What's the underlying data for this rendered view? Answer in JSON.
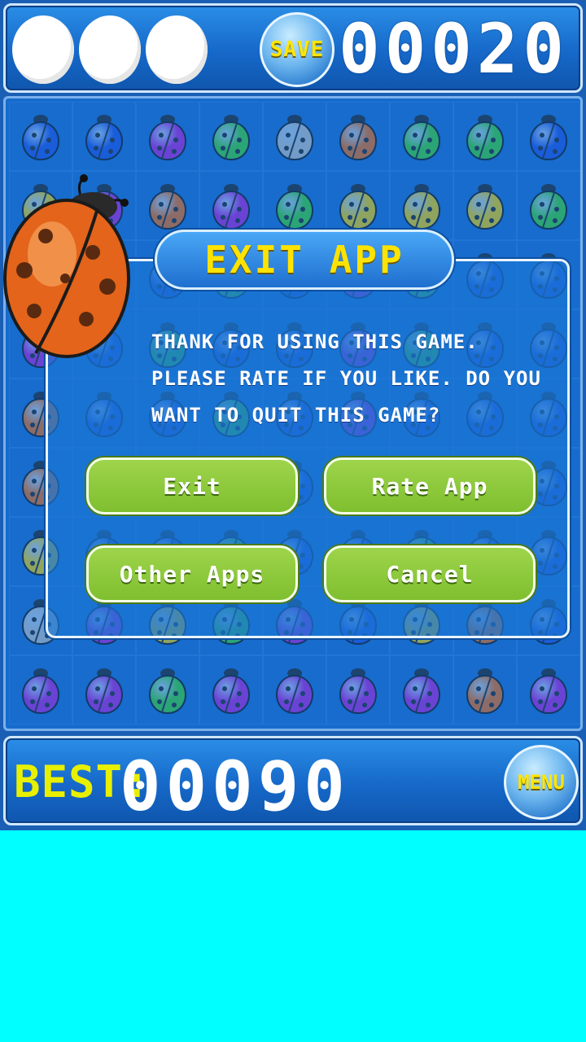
{
  "header": {
    "lives": [
      1,
      2,
      3
    ],
    "save_label": "SAVE",
    "score": "00020"
  },
  "board": {
    "colors": {
      "blue": "#1f4fe0",
      "purple": "#b21fd6",
      "green": "#3fcf2a",
      "silver": "#bfbfbf",
      "orange": "#f06a10",
      "yellow": "#f5d000"
    },
    "rows": [
      [
        "blue",
        "blue",
        "purple",
        "green",
        "silver",
        "orange",
        "green",
        "green",
        "blue"
      ],
      [
        "yellow",
        "purple",
        "orange",
        "purple",
        "green",
        "yellow",
        "yellow",
        "yellow",
        "green"
      ],
      [
        "orange",
        "blue",
        "blue",
        "green",
        "blue",
        "purple",
        "green",
        "blue",
        "blue"
      ],
      [
        "purple",
        "blue",
        "green",
        "blue",
        "blue",
        "purple",
        "green",
        "blue",
        "blue"
      ],
      [
        "orange",
        "blue",
        "blue",
        "green",
        "blue",
        "purple",
        "blue",
        "blue",
        "blue"
      ],
      [
        "orange",
        "blue",
        "green",
        "blue",
        "blue",
        "blue",
        "green",
        "blue",
        "blue"
      ],
      [
        "yellow",
        "blue",
        "blue",
        "green",
        "blue",
        "blue",
        "green",
        "blue",
        "blue"
      ],
      [
        "silver",
        "purple",
        "yellow",
        "green",
        "purple",
        "blue",
        "yellow",
        "orange",
        "blue"
      ],
      [
        "purple",
        "purple",
        "green",
        "purple",
        "purple",
        "purple",
        "purple",
        "orange",
        "purple"
      ]
    ]
  },
  "dialog": {
    "title": "EXIT APP",
    "message": "Thank for using this game. Please rate if you like. Do you want to quit this game?",
    "buttons": {
      "exit": "Exit",
      "rate": "Rate App",
      "other": "Other Apps",
      "cancel": "Cancel"
    }
  },
  "footer": {
    "best_label": "BEST:",
    "best_value": "00090",
    "menu_label": "MENU"
  }
}
